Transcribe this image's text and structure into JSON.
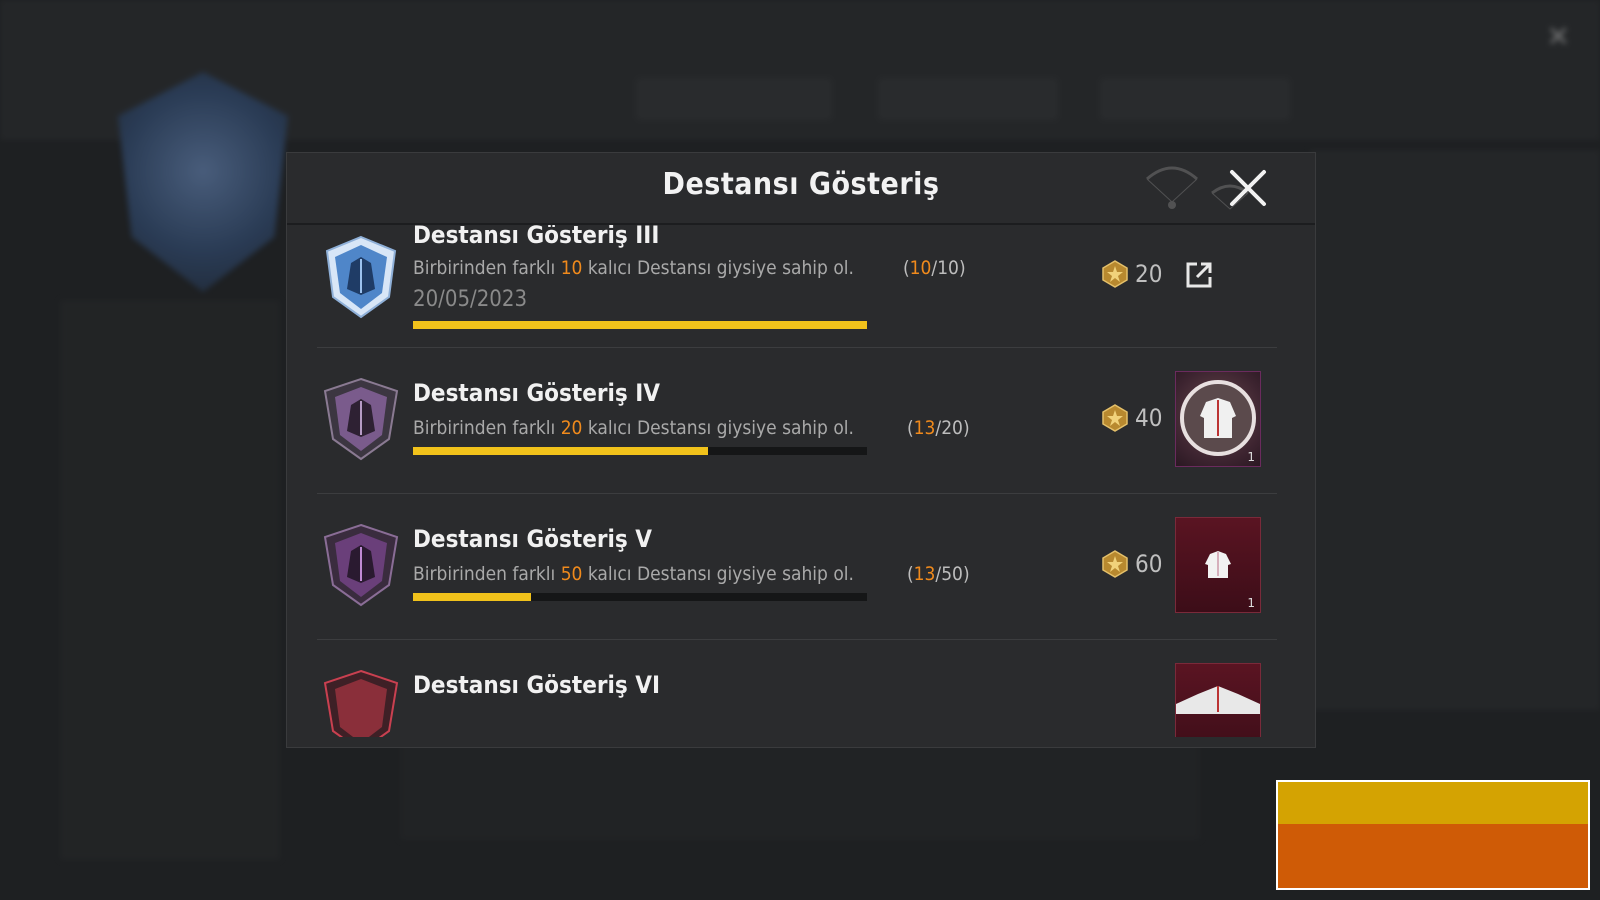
{
  "modal": {
    "title": "Destansı Gösteriş",
    "close_icon": "close-icon"
  },
  "achievements": [
    {
      "title": "Destansı Gösteriş III",
      "desc_prefix": "Birbirinden farklı ",
      "desc_count": "10",
      "desc_suffix": " kalıcı Destansı giysiye sahip ol.",
      "progress_current": "10",
      "progress_total": "10",
      "progress_fraction": 1.0,
      "completed_date": "20/05/2023",
      "points": "20",
      "badge_color": "#6e9bd8",
      "reward": "share-icon"
    },
    {
      "title": "Destansı Gösteriş IV",
      "desc_prefix": "Birbirinden farklı ",
      "desc_count": "20",
      "desc_suffix": " kalıcı Destansı giysiye sahip ol.",
      "progress_current": "13",
      "progress_total": "20",
      "progress_fraction": 0.65,
      "points": "40",
      "badge_color": "#7a5b8c",
      "reward": "jacket-emblem-icon",
      "reward_qty": "1"
    },
    {
      "title": "Destansı Gösteriş V",
      "desc_prefix": "Birbirinden farklı ",
      "desc_count": "50",
      "desc_suffix": " kalıcı Destansı giysiye sahip ol.",
      "progress_current": "13",
      "progress_total": "50",
      "progress_fraction": 0.26,
      "points": "60",
      "badge_color": "#6a3f7a",
      "reward": "jacket-icon",
      "reward_qty": "1"
    },
    {
      "title": "Destansı Gösteriş VI",
      "badge_color": "#8a2f3a",
      "reward": "jacket-icon"
    }
  ],
  "colors": {
    "accent_orange": "#f08a1c",
    "progress_yellow": "#f1c21b",
    "block_yellow": "#d4a302",
    "block_orange": "#cf5b06"
  }
}
